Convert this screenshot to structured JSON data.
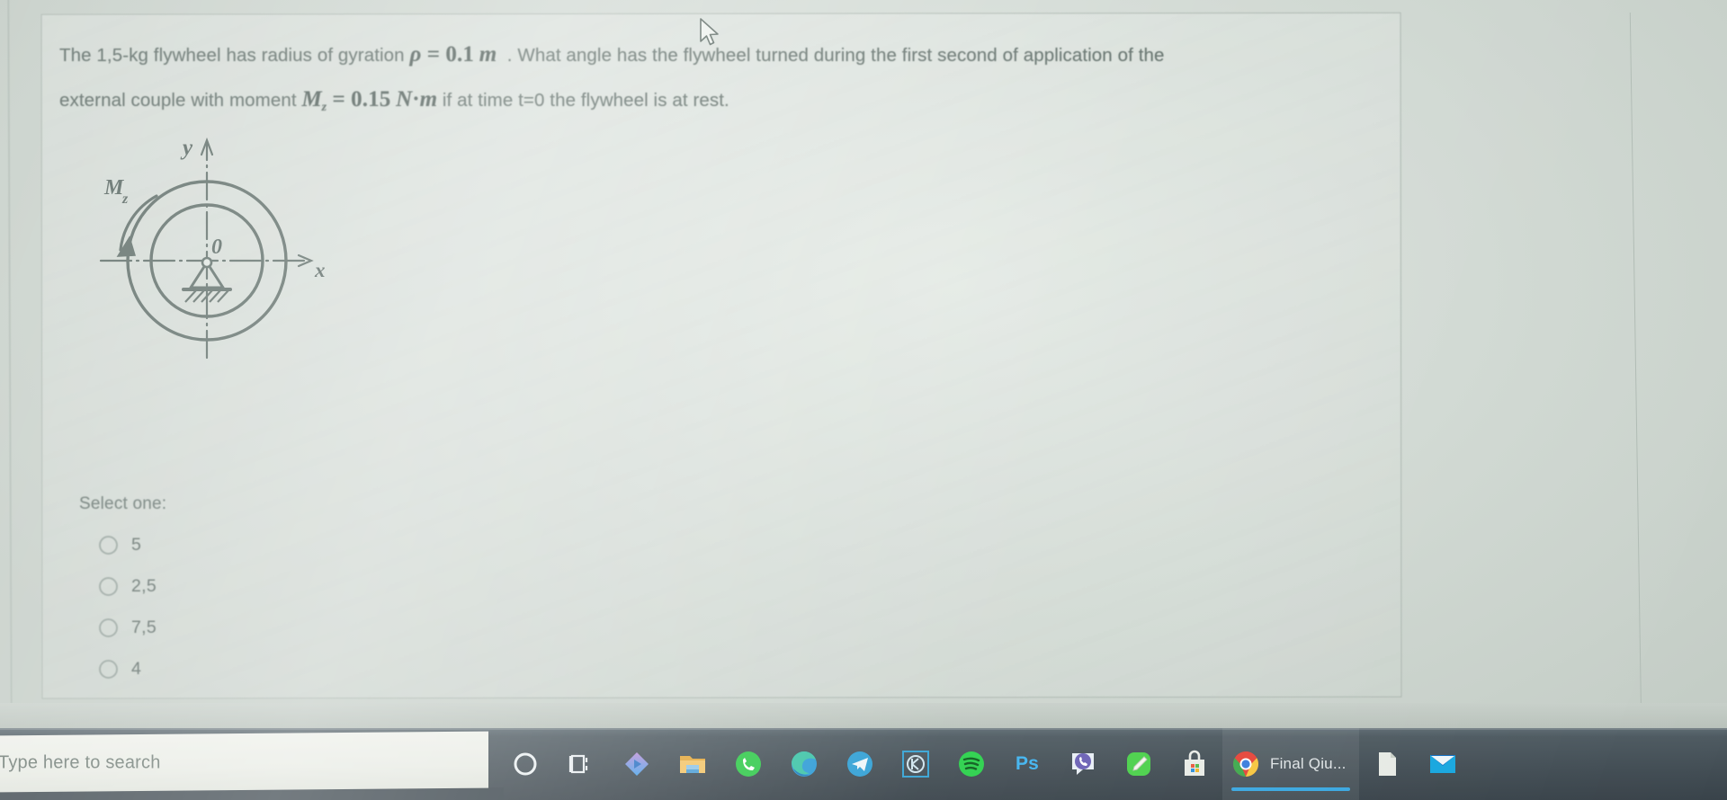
{
  "question": {
    "line1_pre": "The 1,5-kg flywheel has radius of gyration ",
    "rho_symbol": "ρ",
    "rho_eq": " = ",
    "rho_value": "0.1",
    "rho_unit": "m",
    "line1_post": ". What angle has the flywheel turned during the first second of application of the",
    "line2_pre": "external couple with moment ",
    "m_symbol": "M",
    "m_sub": "z",
    "m_eq": " = ",
    "m_value": "0.15",
    "m_unit_n": "N",
    "m_unit_dot": "·",
    "m_unit_m": "m",
    "line2_post": " if at time t=0 the flywheel is at rest."
  },
  "figure": {
    "name": "flywheel-diagram",
    "y_axis_label": "y",
    "x_axis_label": "x",
    "origin_label": "0",
    "moment_label": "M",
    "moment_sub": "z"
  },
  "answers": {
    "prompt": "Select one:",
    "options": [
      {
        "label": "5",
        "selected": false
      },
      {
        "label": "2,5",
        "selected": false
      },
      {
        "label": "7,5",
        "selected": false
      },
      {
        "label": "4",
        "selected": false
      }
    ]
  },
  "taskbar": {
    "search_placeholder": "Type here to search",
    "items": [
      {
        "name": "cortana-icon",
        "label": ""
      },
      {
        "name": "task-view-icon",
        "label": ""
      },
      {
        "name": "xodo-diamond-icon",
        "label": ""
      },
      {
        "name": "file-explorer-icon",
        "label": ""
      },
      {
        "name": "whatsapp-icon",
        "label": ""
      },
      {
        "name": "microsoft-edge-icon",
        "label": ""
      },
      {
        "name": "telegram-icon",
        "label": ""
      },
      {
        "name": "kmplayer-icon",
        "label": ""
      },
      {
        "name": "spotify-icon",
        "label": ""
      },
      {
        "name": "photoshop-icon",
        "label": "Ps"
      },
      {
        "name": "viber-icon",
        "label": ""
      },
      {
        "name": "notes-pencil-icon",
        "label": ""
      },
      {
        "name": "microsoft-store-icon",
        "label": ""
      },
      {
        "name": "google-chrome-window",
        "label": "Final Qiu..."
      },
      {
        "name": "document-file-icon",
        "label": ""
      },
      {
        "name": "mail-icon",
        "label": ""
      }
    ]
  },
  "colors": {
    "screen_bg": "#d2dad4",
    "text": "#5f6d68",
    "taskbar_bg": "#434e55",
    "accent_active": "#3aa7e0"
  }
}
